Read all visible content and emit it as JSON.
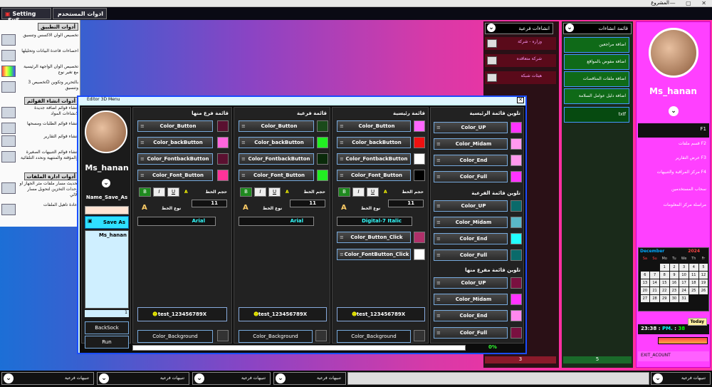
{
  "window": {
    "title": "المشروع"
  },
  "topbar": {
    "setting_label": "Setting _SyS",
    "user_tools_label": "ادوات المستخدم"
  },
  "left_panel": {
    "header1": "أدوات التطبيق",
    "items1": [
      "تخصيص الوان الاكسس وتنسيق",
      "احصاءات قاعدة البيانات وتحليلها",
      "تخصيص الوان الواجهة الرئيسية مع تغير نوع",
      "تخصيص 3D بالتحرير وتكوين وتنسيق"
    ],
    "header2": "أدوات انشاء القوائم",
    "items2": [
      "انشاء قوائم اضافة جديدة لانشاءات المواد",
      "انشاء قوائم الطلبات ومسحها",
      "انشاء قوائم التقارير",
      "انشاء قوائم التنبيهات الصغيرة والمؤقتة والمنتهية ونحدد التلقائية"
    ],
    "header3": "أدوات ادارة الملفات",
    "items3": [
      "تحديث مسار ملفات مثر الجهاز او وحدات التخزين لتحويل مسار الالي",
      "اعادة تاهيل الملفات"
    ]
  },
  "profile": {
    "name": "Ms_hanan",
    "items": [
      "F1",
      "قسم ملفات F2",
      "عرض التقارير F3",
      "مركز المراقبة والتنبيهات F4",
      "سحاب المستخدمين",
      "مراسلة مركز المعلومات"
    ],
    "calendar": {
      "month": "December",
      "year": "2024",
      "weekdays": [
        "Sa",
        "Su",
        "Mo",
        "Tu",
        "We",
        "Th",
        "Fr"
      ],
      "days": [
        "",
        "",
        "1",
        "2",
        "3",
        "4",
        "5",
        "6",
        "7",
        "8",
        "9",
        "10",
        "11",
        "12",
        "13",
        "14",
        "15",
        "16",
        "17",
        "18",
        "19",
        "20",
        "21",
        "22",
        "23",
        "24",
        "25",
        "26",
        "27",
        "28",
        "29",
        "30",
        "31",
        "",
        "",
        "",
        ""
      ]
    },
    "clock": {
      "time": "23:38",
      "ampm": "PM.",
      "seconds": "38",
      "today_label": "Today"
    },
    "footer": "EXIT_ACOUNT"
  },
  "green_panel": {
    "header": "قائمة انشاءات",
    "items": [
      "اضافة مراجعين",
      "اضافة مفوض بالمواقع",
      "اضافة ملفات المناقصات",
      "اضافة دليل عوامل السلامة",
      "txtf"
    ],
    "count": "5"
  },
  "red_panel": {
    "header": "انشاءات فرعية",
    "items": [
      "وزاره - شركة",
      "شركة متعاقده",
      "هيئات شبكة"
    ],
    "count": "3"
  },
  "dialog": {
    "title": "Editor 3D Menu",
    "profile_name": "Ms_hanan",
    "name_save_as": "Name_Save_As",
    "save_as": "Save As",
    "list_item": "Ms_hanan",
    "list_count": "1",
    "back_btn": "BackSock",
    "run_btn": "Run",
    "progress": "0%",
    "col_main": {
      "header": "تلوين قائمة الرئيسية",
      "b1": "Color_UP",
      "b2": "Color_Midam",
      "b3": "Color_End",
      "b4": "Color_Full",
      "sub_header": "تلوين قائمة الفرعية",
      "s1": "Color_UP",
      "s2": "Color_Midam",
      "s3": "Color_End",
      "s4": "Color_Full",
      "sub2_header": "تلوين قائمة مفرع منها",
      "t1": "Color_UP",
      "t2": "Color_Midam",
      "t3": "Color_End",
      "t4": "Color_Full",
      "bg": "Color_Full"
    },
    "col_a": {
      "header": "قائمة رئيسية",
      "b1": "Color_Button",
      "b2": "Color_backButton",
      "b3": "Color_FontbackButton",
      "b4": "Color_Font_Button",
      "size_label": "حجم الخط",
      "size": "11",
      "font_label": "نوع الخط",
      "font": "Digital-7 Italic",
      "b5": "Color_Button_Click",
      "b6": "Color_FontButton_Click",
      "test": "test_123456789X",
      "bg": "Color_Background"
    },
    "col_b": {
      "header": "قائمة فرعية",
      "b1": "Color_Button",
      "b2": "Color_backButton",
      "b3": "Color_FontbackButton",
      "b4": "Color_Font_Button",
      "size_label": "حجم الخط",
      "size": "11",
      "font_label": "نوع الخط",
      "font": "Arial",
      "test": "test_123456789X",
      "bg": "Color_Background"
    },
    "col_c": {
      "header": "قائمة فرع منها",
      "b1": "Color_Button",
      "b2": "Color_backButton",
      "b3": "Color_FontbackButton",
      "b4": "Color_Font_Button",
      "size_label": "حجم الخط",
      "size": "11",
      "font_label": "نوع الخط",
      "font": "Arial",
      "test": "test_123456789X",
      "bg": "Color_Background"
    },
    "fmt": [
      "B",
      "I",
      "U"
    ]
  },
  "taskbar": {
    "items": [
      "تنبيهات فرعية",
      "تنبيهات فرعية",
      "تنبيهات فرعية",
      "تنبيهات فرعية"
    ],
    "right": "تنبيهات فرعية"
  }
}
